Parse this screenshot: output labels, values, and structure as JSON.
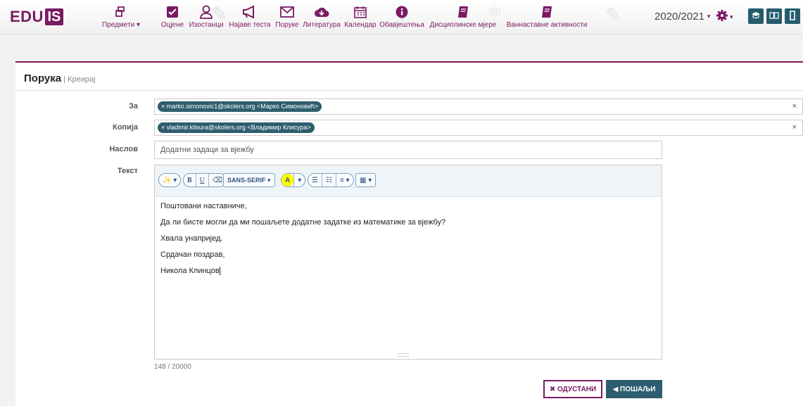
{
  "logo": {
    "edu": "EDU",
    "is": "IS"
  },
  "nav": [
    {
      "label": "Предмети ▾",
      "icon": "subjects-icon"
    },
    {
      "label": "Оцјене",
      "icon": "check-square-icon"
    },
    {
      "label": "Изостанци",
      "icon": "user-icon"
    },
    {
      "label": "Најаве теста",
      "icon": "megaphone-icon"
    },
    {
      "label": "Поруке",
      "icon": "envelope-icon"
    },
    {
      "label": "Литература",
      "icon": "cloud-download-icon"
    },
    {
      "label": "Календар",
      "icon": "calendar-icon"
    },
    {
      "label": "Обавјештења",
      "icon": "info-icon"
    },
    {
      "label": "Дисциплинске мјере",
      "icon": "book-icon"
    },
    {
      "label": "Ваннаставне активности",
      "icon": "book-icon"
    }
  ],
  "header": {
    "year": "2020/2021",
    "caret": "▾"
  },
  "page": {
    "title": "Порука",
    "separator": " | ",
    "subtitle": "Креирај"
  },
  "form": {
    "to_label": "За",
    "to_tag": "× marko.simonovic1@skolers.org <Марко Симоновић>",
    "cc_label": "Копија",
    "cc_tag": "× vladimir.klisura@skolers.org <Владимир Клисура>",
    "clear": "×",
    "subject_label": "Наслов",
    "subject_value": "Додатни задаци за вјежбу",
    "text_label": "Текст"
  },
  "toolbar": {
    "magic": "✨ ▾",
    "bold": "B",
    "underline": "U",
    "eraser": "⌫",
    "font": "SANS-SERIF ▾",
    "color": "A",
    "color_caret": "▾",
    "ul": "☰",
    "ol": "☷",
    "align": "≡ ▾",
    "table": "▦ ▾"
  },
  "message": {
    "line1": "Поштовани наставниче,",
    "line2": "Да ли бисте могли да ми пошаљете додатне задатке из математике за вјежбу?",
    "line3": "Хвала унапријед.",
    "line4": "Срдачан поздрав,",
    "line5": "Никола Клинцов"
  },
  "counter": "148 / 20000",
  "buttons": {
    "cancel": "✖ ОДУСТАНИ",
    "send": "◀ ПОШАЉИ"
  },
  "colors": {
    "brand": "#7b1a63",
    "accent": "#2e5d6f"
  }
}
